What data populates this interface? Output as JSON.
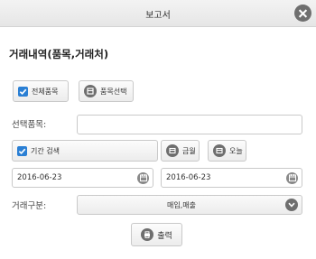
{
  "window": {
    "title": "보고서"
  },
  "section": {
    "title": "거래내역(품목,거래처)"
  },
  "items": {
    "all_items_label": "전체품목",
    "all_items_checked": true,
    "select_item_label": "품목선택",
    "selected_item_label": "선택품목:",
    "selected_item_value": ""
  },
  "period": {
    "search_label": "기간 검색",
    "search_checked": true,
    "this_month_label": "금월",
    "today_label": "오늘",
    "start_date": "2016-06-23",
    "end_date": "2016-06-23"
  },
  "trade_type": {
    "label": "거래구분:",
    "selected": "매입,매출"
  },
  "actions": {
    "print_label": "출력"
  },
  "icons": {
    "close": "close-icon",
    "check": "check-icon",
    "circle": "circle-icon",
    "calendar": "calendar-icon",
    "chevron": "chevron-down-icon",
    "print": "print-icon"
  }
}
